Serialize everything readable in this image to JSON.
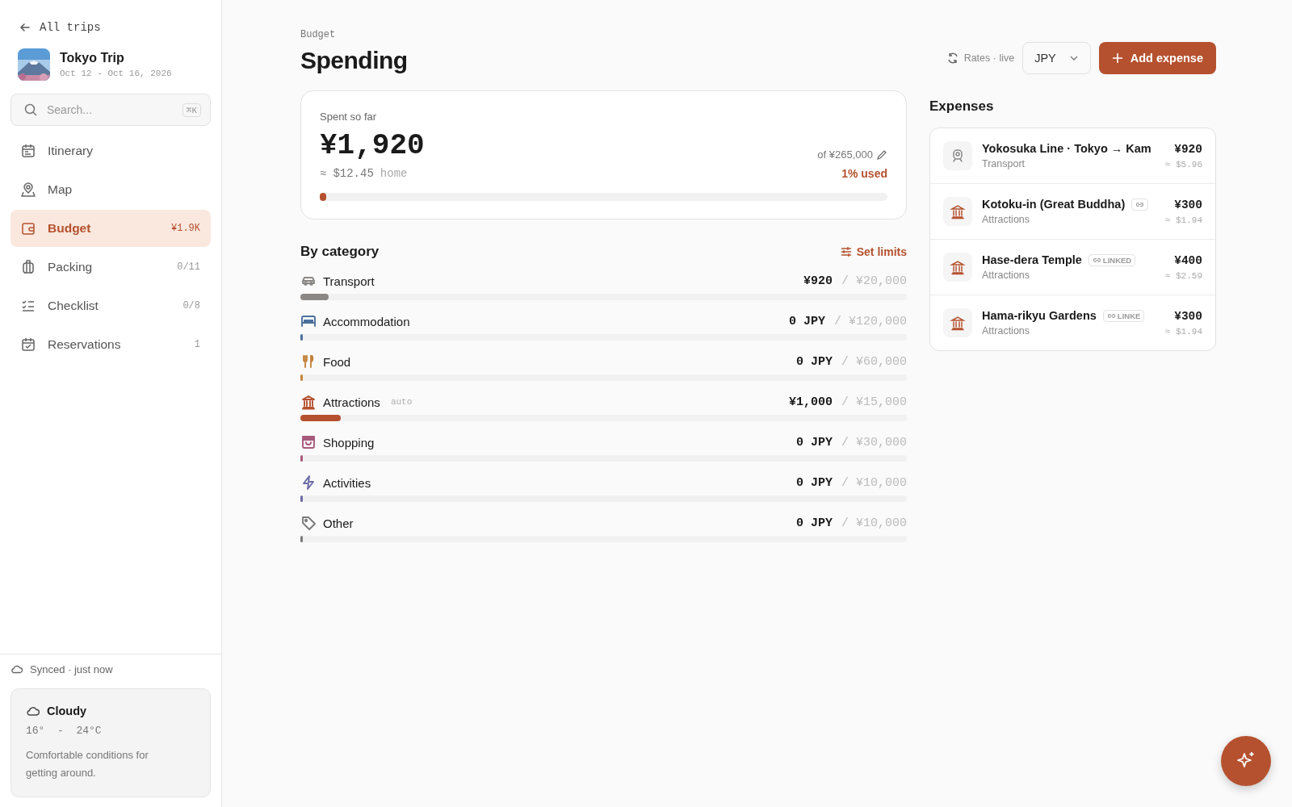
{
  "sidebar": {
    "back_link": "All trips",
    "trip": {
      "title": "Tokyo Trip",
      "dates": "Oct 12 - Oct 16, 2026"
    },
    "search": {
      "placeholder": "Search...",
      "shortcut": "⌘K"
    },
    "items": [
      {
        "label": "Itinerary",
        "selected": false
      },
      {
        "label": "Map",
        "selected": false
      },
      {
        "label": "Budget",
        "count": "¥1.9K",
        "selected": true
      },
      {
        "label": "Packing",
        "count": "0/11",
        "selected": false
      },
      {
        "label": "Checklist",
        "count": "0/8",
        "selected": false
      },
      {
        "label": "Reservations",
        "count": "1",
        "selected": false
      }
    ],
    "sync_status": "Synced · just now",
    "weather": {
      "condition": "Cloudy",
      "range": "16°  -  24°C",
      "note": "Comfortable conditions for getting around."
    }
  },
  "header": {
    "breadcrumb": "Budget",
    "title": "Spending",
    "rates": "Rates · live",
    "currency": "JPY",
    "add_button": "Add expense"
  },
  "summary": {
    "label": "Spent so far",
    "amount": "¥1,920",
    "home_prefix": "≈",
    "home_amount": "$12.45",
    "home_label": "home",
    "budget": "of ¥265,000",
    "used": "1% used",
    "level": 0.01
  },
  "categories": {
    "title": "By category",
    "action": "Set limits",
    "items": [
      {
        "name": "Transport",
        "color": "#8a8784",
        "spent": "¥920",
        "limit": "/ ¥20,000",
        "level": 0.046
      },
      {
        "name": "Accommodation",
        "color": "#4d6f9c",
        "spent": "0 JPY",
        "limit": "/ ¥120,000",
        "level": 0
      },
      {
        "name": "Food",
        "color": "#c4843e",
        "spent": "0 JPY",
        "limit": "/ ¥60,000",
        "level": 0
      },
      {
        "name": "Attractions",
        "color": "#b5512e",
        "tag": "auto",
        "spent": "¥1,000",
        "limit": "/ ¥15,000",
        "level": 0.067
      },
      {
        "name": "Shopping",
        "color": "#a85a7c",
        "spent": "0 JPY",
        "limit": "/ ¥30,000",
        "level": 0
      },
      {
        "name": "Activities",
        "color": "#6b6aa6",
        "spent": "0 JPY",
        "limit": "/ ¥10,000",
        "level": 0
      },
      {
        "name": "Other",
        "color": "#7a7a7a",
        "spent": "0 JPY",
        "limit": "/ ¥10,000",
        "level": 0
      }
    ]
  },
  "expenses": {
    "title": "Expenses",
    "items": [
      {
        "name": "Yokosuka Line · Tokyo → Kam",
        "kind": "transport",
        "category": "Transport",
        "amount": "¥920",
        "home": "$5.96",
        "linked": false
      },
      {
        "name": "Kotoku-in (Great Buddha)",
        "kind": "attraction",
        "category": "Attractions",
        "amount": "¥300",
        "home": "$1.94",
        "linked": true
      },
      {
        "name": "Hase-dera Temple",
        "kind": "attraction",
        "category": "Attractions",
        "amount": "¥400",
        "home": "$2.59",
        "linked": true,
        "badge": "LINKED"
      },
      {
        "name": "Hama-rikyu Gardens",
        "kind": "attraction",
        "category": "Attractions",
        "amount": "¥300",
        "home": "$1.94",
        "linked": true,
        "badge": "LINKE"
      }
    ],
    "approx": "≈"
  }
}
